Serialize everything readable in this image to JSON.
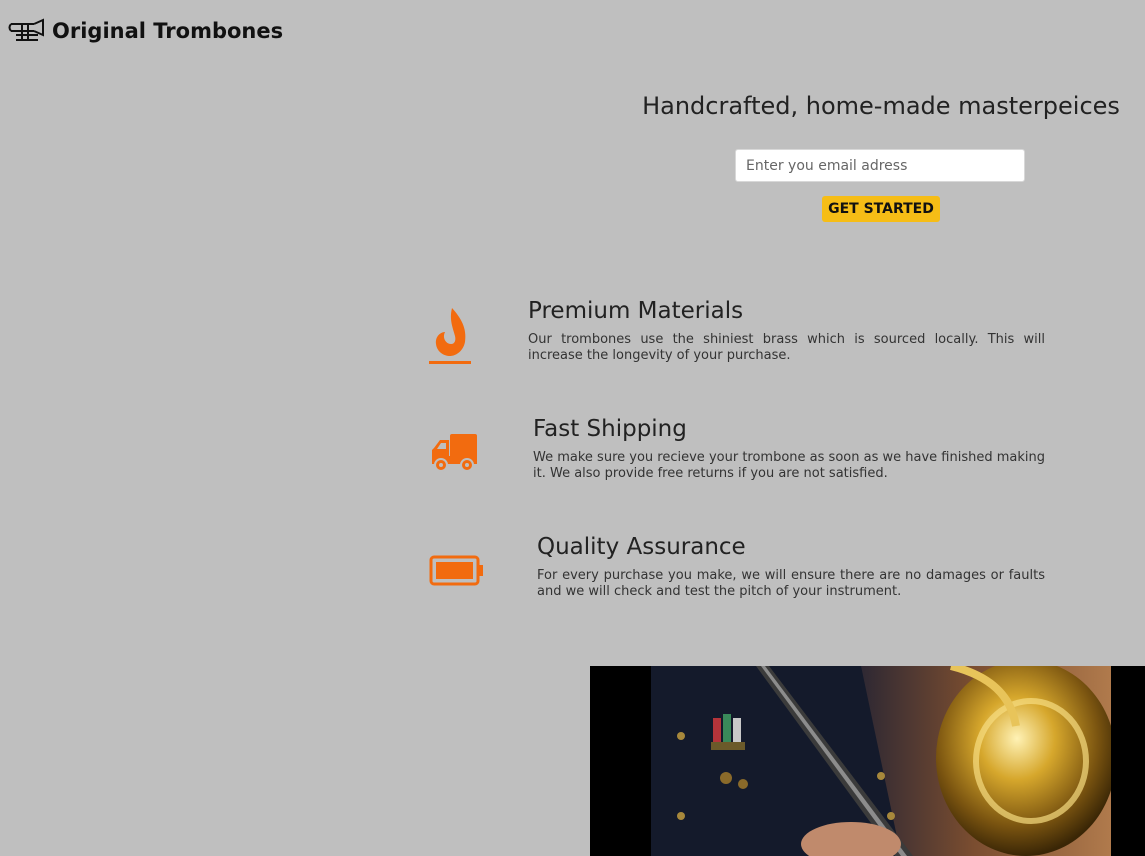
{
  "header": {
    "brand": "Original Trombones",
    "logo_icon": "trombone-icon"
  },
  "hero": {
    "title": "Handcrafted, home-made masterpeices",
    "email_placeholder": "Enter you email adress",
    "button_label": "GET STARTED"
  },
  "features": [
    {
      "icon": "fire-icon",
      "title": "Premium Materials",
      "description": "Our trombones use the shiniest brass which is sourced locally. This will increase the longevity of your purchase."
    },
    {
      "icon": "truck-icon",
      "title": "Fast Shipping",
      "description": "We make sure you recieve your trombone as soon as we have finished making it. We also provide free returns if you are not satisfied."
    },
    {
      "icon": "battery-icon",
      "title": "Quality Assurance",
      "description": "For every purchase you make, we will ensure there are no damages or faults and we will check and test the pitch of your instrument."
    }
  ],
  "colors": {
    "background": "#bfbfbf",
    "accent_orange": "#f26b0f",
    "cta_yellow": "#f6bd16"
  }
}
